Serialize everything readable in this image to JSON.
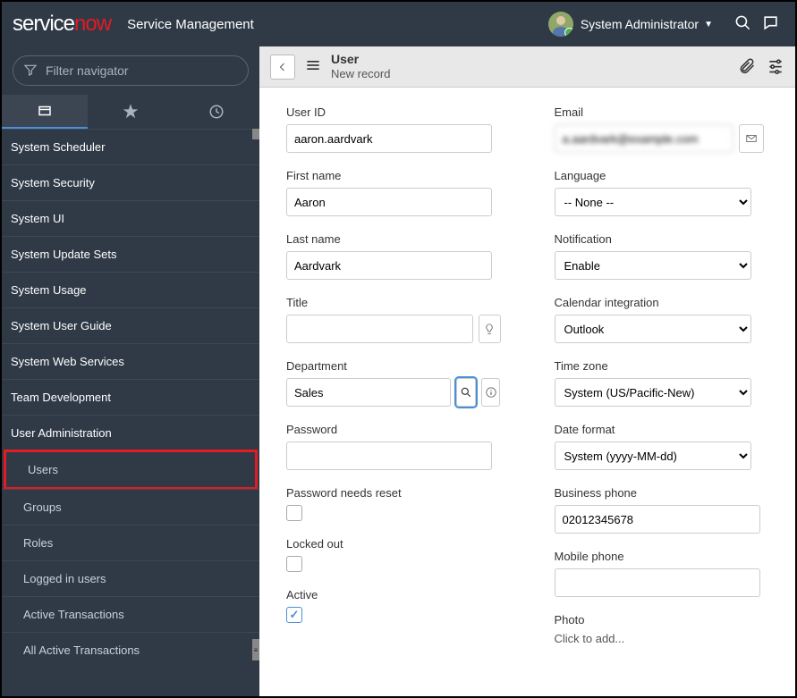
{
  "header": {
    "logo_service": "service",
    "logo_now": "now",
    "app_title": "Service Management",
    "user_name": "System Administrator"
  },
  "sidebar": {
    "filter_placeholder": "Filter navigator",
    "items": [
      {
        "label": "System Scheduler",
        "sub": false
      },
      {
        "label": "System Security",
        "sub": false
      },
      {
        "label": "System UI",
        "sub": false
      },
      {
        "label": "System Update Sets",
        "sub": false
      },
      {
        "label": "System Usage",
        "sub": false
      },
      {
        "label": "System User Guide",
        "sub": false
      },
      {
        "label": "System Web Services",
        "sub": false
      },
      {
        "label": "Team Development",
        "sub": false
      },
      {
        "label": "User Administration",
        "sub": false
      },
      {
        "label": "Users",
        "sub": true,
        "highlighted": true
      },
      {
        "label": "Groups",
        "sub": true
      },
      {
        "label": "Roles",
        "sub": true
      },
      {
        "label": "Logged in users",
        "sub": true
      },
      {
        "label": "Active Transactions",
        "sub": true
      },
      {
        "label": "All Active Transactions",
        "sub": true
      }
    ]
  },
  "titlebar": {
    "entity": "User",
    "subtitle": "New record"
  },
  "form": {
    "left": {
      "user_id_label": "User ID",
      "user_id_value": "aaron.aardvark",
      "first_name_label": "First name",
      "first_name_value": "Aaron",
      "last_name_label": "Last name",
      "last_name_value": "Aardvark",
      "title_label": "Title",
      "title_value": "",
      "department_label": "Department",
      "department_value": "Sales",
      "password_label": "Password",
      "password_value": "",
      "password_reset_label": "Password needs reset",
      "password_reset_checked": false,
      "locked_out_label": "Locked out",
      "locked_out_checked": false,
      "active_label": "Active",
      "active_checked": true
    },
    "right": {
      "email_label": "Email",
      "email_value": "a.aardvark@example.com",
      "language_label": "Language",
      "language_value": "-- None --",
      "notification_label": "Notification",
      "notification_value": "Enable",
      "calendar_label": "Calendar integration",
      "calendar_value": "Outlook",
      "timezone_label": "Time zone",
      "timezone_value": "System (US/Pacific-New)",
      "dateformat_label": "Date format",
      "dateformat_value": "System (yyyy-MM-dd)",
      "business_phone_label": "Business phone",
      "business_phone_value": "02012345678",
      "mobile_phone_label": "Mobile phone",
      "mobile_phone_value": "",
      "photo_label": "Photo",
      "photo_action": "Click to add..."
    }
  }
}
